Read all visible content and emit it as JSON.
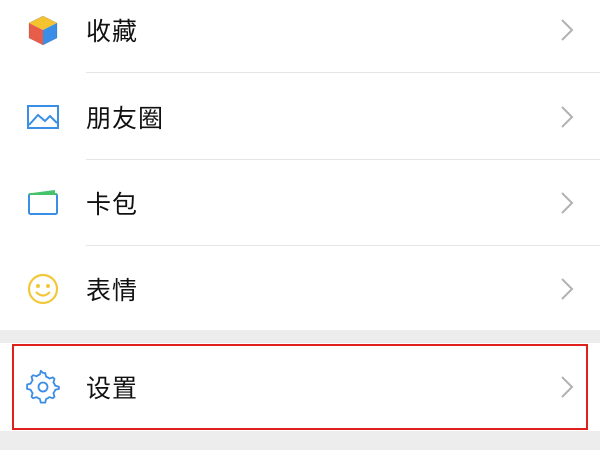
{
  "menu": {
    "items": [
      {
        "label": "收藏",
        "icon": "favorites-cube-icon"
      },
      {
        "label": "朋友圈",
        "icon": "moments-picture-icon"
      },
      {
        "label": "卡包",
        "icon": "card-wallet-icon"
      },
      {
        "label": "表情",
        "icon": "sticker-smiley-icon"
      }
    ],
    "settings": {
      "label": "设置",
      "icon": "gear-icon"
    }
  },
  "colors": {
    "highlight": "#e0201c",
    "icon_blue": "#3a8ee6",
    "smiley": "#f3c73a"
  }
}
